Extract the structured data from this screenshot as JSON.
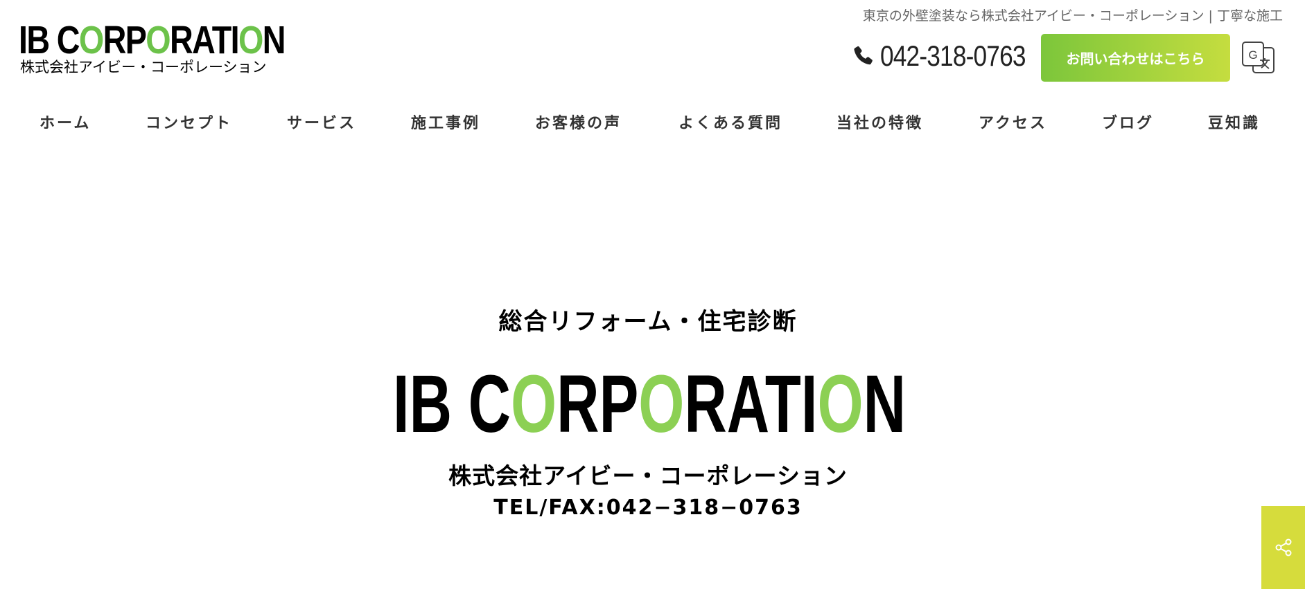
{
  "header": {
    "logo": {
      "main_parts": [
        "IB C",
        "O",
        "RP",
        "O",
        "RATI",
        "O",
        "N"
      ],
      "sub": "株式会社アイビー・コーポレーション"
    },
    "tagline": "東京の外壁塗装なら株式会社アイビー・コーポレーション | 丁寧な施工",
    "phone": "042-318-0763",
    "phone_icon": "phone-icon",
    "contact_label": "お問い合わせはこちら",
    "translate_icon": "google-translate-icon"
  },
  "nav": {
    "items": [
      {
        "label": "ホーム"
      },
      {
        "label": "コンセプト"
      },
      {
        "label": "サービス"
      },
      {
        "label": "施工事例"
      },
      {
        "label": "お客様の声"
      },
      {
        "label": "よくある質問"
      },
      {
        "label": "当社の特徴"
      },
      {
        "label": "アクセス"
      },
      {
        "label": "ブログ"
      },
      {
        "label": "豆知識"
      }
    ]
  },
  "hero": {
    "tagline": "総合リフォーム・住宅診断",
    "logo_parts": [
      "IB C",
      "O",
      "RP",
      "O",
      "RATI",
      "O",
      "N"
    ],
    "company": "株式会社アイビー・コーポレーション",
    "tel": "TEL/FAX:042−318−0763"
  },
  "share": {
    "icon": "share-icon"
  },
  "colors": {
    "brand_green": "#7cc63b",
    "brand_lime": "#c5dd3f",
    "share_bg": "#d6dc3c",
    "logo_o": "#8cd054"
  }
}
